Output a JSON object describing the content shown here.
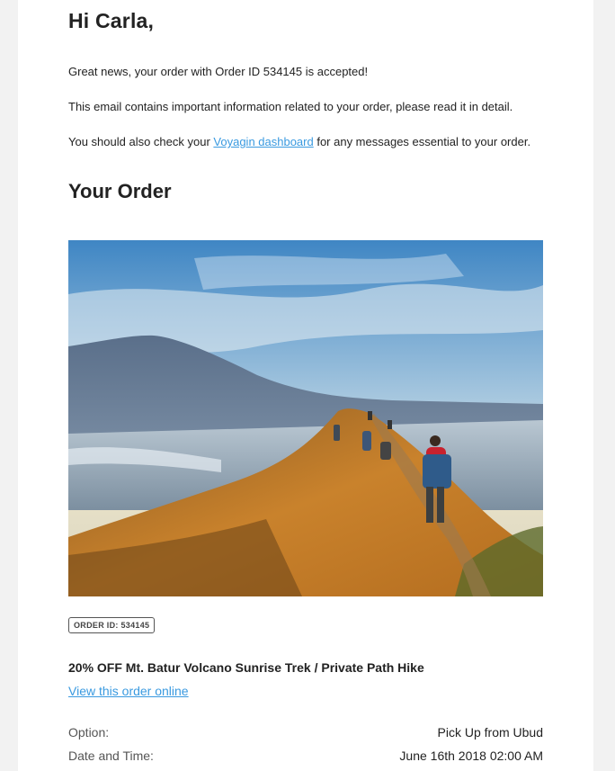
{
  "email": {
    "greeting": "Hi Carla,",
    "intro": "Great news, your order with Order ID 534145 is accepted!",
    "info": "This email contains important information related to your order, please read it in detail.",
    "dashboard_prefix": "You should also check your ",
    "dashboard_link": "Voyagin dashboard",
    "dashboard_suffix": " for any messages essential to your order."
  },
  "order": {
    "section_title": "Your Order",
    "image_alt": "Hikers on a grassy ridge with a volcano and lake behind at sunrise",
    "order_id_badge": "ORDER ID: 534145",
    "product_title": "20% OFF Mt. Batur Volcano Sunrise Trek / Private Path Hike",
    "view_online": "View this order online",
    "details": [
      {
        "label": "Option:",
        "value": "Pick Up from Ubud"
      },
      {
        "label": "Date and Time:",
        "value": "June 16th 2018 02:00 AM"
      }
    ]
  },
  "colors": {
    "link": "#3a9ae0",
    "text": "#222222",
    "background": "#f2f2f2"
  }
}
